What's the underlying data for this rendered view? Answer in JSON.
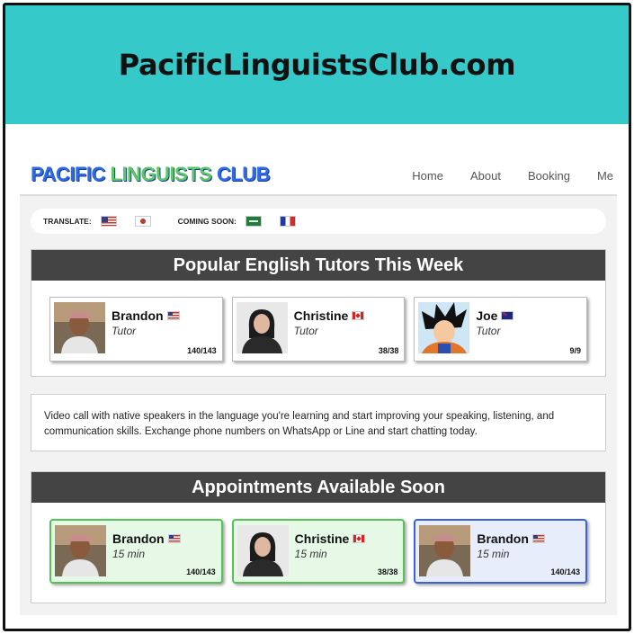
{
  "banner": {
    "title": "PacificLinguistsClub.com"
  },
  "logo": {
    "word1": "PACIFIC",
    "word2": "LINGUISTS",
    "word3": "CLUB"
  },
  "nav": {
    "items": [
      "Home",
      "About",
      "Booking",
      "Me"
    ]
  },
  "translate": {
    "label": "TRANSLATE:",
    "flags": [
      "us-flag-icon",
      "jp-flag-icon"
    ],
    "coming_label": "COMING SOON:",
    "coming_flags": [
      "sa-flag-icon",
      "fr-flag-icon"
    ]
  },
  "popular": {
    "title": "Popular English Tutors This Week",
    "cards": [
      {
        "name": "Brandon",
        "flag": "us-flag-icon",
        "role": "Tutor",
        "count": "140/143"
      },
      {
        "name": "Christine",
        "flag": "ca-flag-icon",
        "role": "Tutor",
        "count": "38/38"
      },
      {
        "name": "Joe",
        "flag": "au-flag-icon",
        "role": "Tutor",
        "count": "9/9"
      }
    ]
  },
  "description": "Video call with native speakers in the language you're learning and start improving your speaking, listening, and communication skills. Exchange phone numbers on WhatsApp or Line and start chatting today.",
  "appointments": {
    "title": "Appointments Available Soon",
    "cards": [
      {
        "name": "Brandon",
        "flag": "us-flag-icon",
        "duration": "15 min",
        "count": "140/143",
        "accent": "#55c255"
      },
      {
        "name": "Christine",
        "flag": "ca-flag-icon",
        "duration": "15 min",
        "count": "38/38",
        "accent": "#55c255"
      },
      {
        "name": "Brandon",
        "flag": "us-flag-icon",
        "duration": "15 min",
        "count": "140/143",
        "accent": "#3e62d6"
      }
    ]
  },
  "colors": {
    "banner": "#36c9ca",
    "panel_header": "#444444"
  }
}
